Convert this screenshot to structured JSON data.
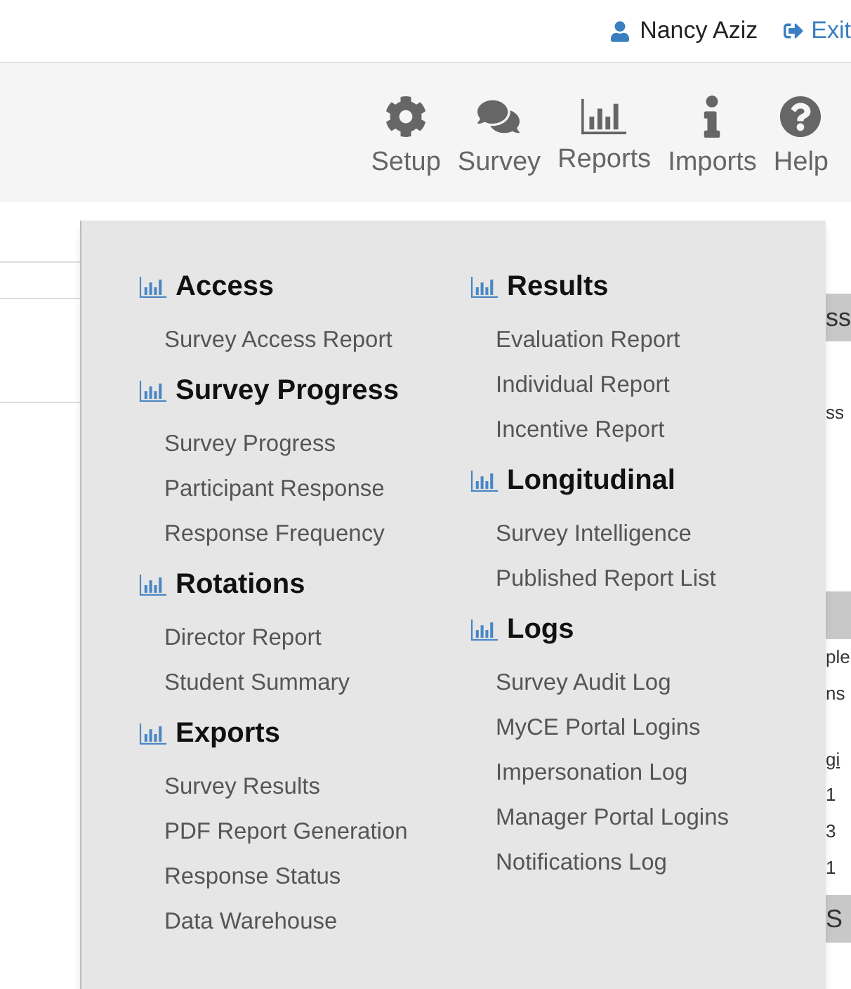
{
  "user_bar": {
    "user_name": "Nancy Aziz",
    "exit_link": "Exit"
  },
  "nav": [
    {
      "kind": "gear",
      "label": "Setup"
    },
    {
      "kind": "comments",
      "label": "Survey"
    },
    {
      "kind": "chart",
      "label": "Reports"
    },
    {
      "kind": "info",
      "label": "Imports"
    },
    {
      "kind": "help",
      "label": "Help"
    }
  ],
  "reports_menu": {
    "columns": [
      [
        {
          "title": "Access",
          "items": [
            "Survey Access Report"
          ]
        },
        {
          "title": "Survey Progress",
          "items": [
            "Survey Progress",
            "Participant Response",
            "Response Frequency"
          ]
        },
        {
          "title": "Rotations",
          "items": [
            "Director Report",
            "Student Summary"
          ]
        },
        {
          "title": "Exports",
          "items": [
            "Survey Results",
            "PDF Report Generation",
            "Response Status",
            "Data Warehouse"
          ]
        }
      ],
      [
        {
          "title": "Results",
          "items": [
            "Evaluation Report",
            "Individual Report",
            "Incentive Report"
          ]
        },
        {
          "title": "Longitudinal",
          "items": [
            "Survey Intelligence",
            "Published Report List"
          ]
        },
        {
          "title": "Logs",
          "items": [
            "Survey Audit Log",
            "MyCE Portal Logins",
            "Impersonation Log",
            "Manager Portal Logins",
            "Notifications Log"
          ]
        }
      ]
    ]
  },
  "background_fragments": [
    {
      "kind": "header",
      "text": "ss"
    },
    {
      "kind": "text",
      "text": "ss"
    },
    {
      "kind": "header"
    },
    {
      "kind": "text",
      "text": "ple"
    },
    {
      "kind": "text",
      "text": "ns"
    },
    {
      "kind": "link",
      "text": "gi"
    },
    {
      "kind": "text",
      "text": "1"
    },
    {
      "kind": "text",
      "text": "3"
    },
    {
      "kind": "text",
      "text": "1"
    },
    {
      "kind": "header",
      "text": "S"
    }
  ]
}
